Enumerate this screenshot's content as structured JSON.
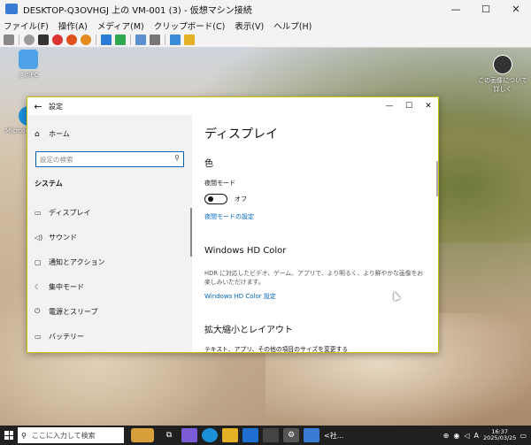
{
  "host": {
    "title": "DESKTOP-Q3OVHGJ 上の VM-001 (3) - 仮想マシン接続",
    "controls": {
      "minimize": "—",
      "maximize": "☐",
      "close": "✕"
    },
    "menu": [
      "ファイル(F)",
      "操作(A)",
      "メディア(M)",
      "クリップボード(C)",
      "表示(V)",
      "ヘルプ(H)"
    ]
  },
  "desktop": {
    "icons": [
      {
        "label": "このPC"
      },
      {
        "label": "Microsoft Edge"
      },
      {
        "label": "この画像について詳しく"
      }
    ]
  },
  "settings": {
    "title": "設定",
    "sidebar": {
      "home": "ホーム",
      "search_placeholder": "設定の検索",
      "section": "システム",
      "items": [
        {
          "label": "ディスプレイ",
          "icon": "display-icon"
        },
        {
          "label": "サウンド",
          "icon": "speaker-icon"
        },
        {
          "label": "通知とアクション",
          "icon": "notification-icon"
        },
        {
          "label": "集中モード",
          "icon": "moon-icon"
        },
        {
          "label": "電源とスリープ",
          "icon": "power-icon"
        },
        {
          "label": "バッテリー",
          "icon": "battery-icon"
        }
      ]
    },
    "content": {
      "heading": "ディスプレイ",
      "color_section": "色",
      "night_mode_label": "夜間モード",
      "night_mode_state": "オフ",
      "night_mode_link": "夜間モードの設定",
      "hd_color_title": "Windows HD Color",
      "hd_color_desc": "HDR に対応したビデオ、ゲーム、アプリで、より明るく、より鮮やかな画像をお楽しみいただけます。",
      "hd_color_link": "Windows HD Color 設定",
      "scale_title": "拡大縮小とレイアウト",
      "scale_desc": "テキスト、アプリ、その他の項目のサイズを変更する"
    }
  },
  "taskbar": {
    "search_placeholder": "ここに入力して検索",
    "ime": "A",
    "time": "16:37",
    "date": "2025/03/25",
    "task_label": "<社..."
  }
}
